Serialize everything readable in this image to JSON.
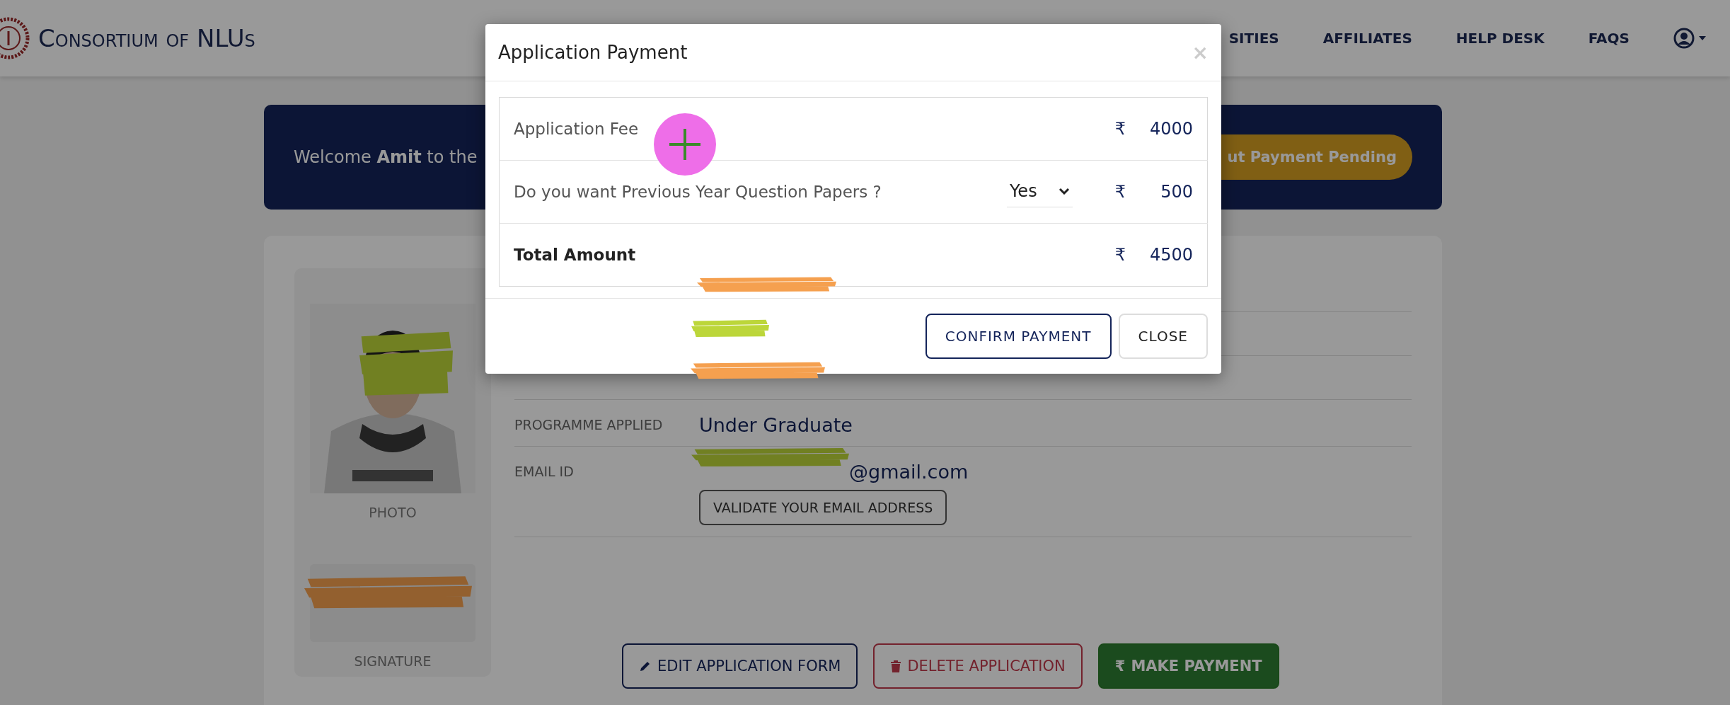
{
  "header": {
    "brand": "Consortium of NLUs",
    "nav": [
      {
        "label": "SITIES"
      },
      {
        "label": "AFFILIATES"
      },
      {
        "label": "HELP DESK"
      },
      {
        "label": "FAQS"
      }
    ]
  },
  "banner": {
    "greeting": "Welcome **Amit** to the",
    "status": "ut Payment Pending"
  },
  "profile": {
    "photo_label": "PHOTO",
    "signature_label": "SIGNATURE",
    "fields": [
      {
        "label": "PROGRAMME APPLIED",
        "value": "Under Graduate",
        "kind": "text"
      },
      {
        "label": "EMAIL ID",
        "value": "@gmail.com",
        "kind": "email"
      }
    ],
    "validate_button": "VALIDATE YOUR EMAIL ADDRESS",
    "actions": [
      {
        "label": "EDIT APPLICATION FORM",
        "kind": "edit"
      },
      {
        "label": "DELETE APPLICATION",
        "kind": "delete"
      },
      {
        "label": "MAKE PAYMENT",
        "kind": "pay",
        "icon_text": "₹"
      }
    ]
  },
  "modal": {
    "title": "Application Payment",
    "close": "×",
    "rows": [
      {
        "label": "Application Fee",
        "currency": "₹",
        "amount": "4000",
        "kind": "item"
      },
      {
        "label": "Do you want Previous Year Question Papers ?",
        "select": "Yes",
        "currency": "₹",
        "amount": "500",
        "kind": "select"
      },
      {
        "label": "Total Amount",
        "currency": "₹",
        "amount": "4500",
        "kind": "total"
      }
    ],
    "buttons": [
      {
        "label": "CONFIRM PAYMENT",
        "kind": "primary"
      },
      {
        "label": "CLOSE",
        "kind": "secondary"
      }
    ]
  }
}
